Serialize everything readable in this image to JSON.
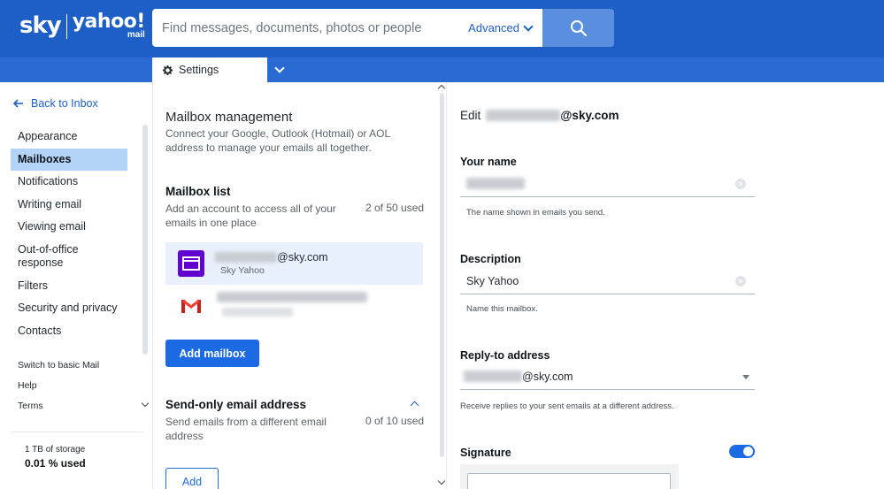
{
  "header": {
    "logo_sky": "sky",
    "logo_yahoo": "yahoo!",
    "logo_mail": "mail",
    "search_placeholder": "Find messages, documents, photos or people",
    "advanced_label": "Advanced",
    "settings_tab_label": "Settings"
  },
  "leftnav": {
    "back_label": "Back to Inbox",
    "items": [
      {
        "label": "Appearance",
        "active": false
      },
      {
        "label": "Mailboxes",
        "active": true
      },
      {
        "label": "Notifications",
        "active": false
      },
      {
        "label": "Writing email",
        "active": false
      },
      {
        "label": "Viewing email",
        "active": false
      },
      {
        "label": "Out-of-office response",
        "active": false
      },
      {
        "label": "Filters",
        "active": false
      },
      {
        "label": "Security and privacy",
        "active": false
      },
      {
        "label": "Contacts",
        "active": false
      }
    ],
    "switch_basic": "Switch to basic Mail",
    "help": "Help",
    "terms": "Terms",
    "storage_total": "1 TB of storage",
    "storage_used": "0.01 % used"
  },
  "middle": {
    "management_title": "Mailbox management",
    "management_desc": "Connect your Google, Outlook (Hotmail) or AOL address to manage your emails all together.",
    "list_title": "Mailbox list",
    "list_desc": "Add an account to access all of your emails in one place",
    "list_count": "2 of 50 used",
    "mailboxes": [
      {
        "address_suffix": "@sky.com",
        "name": "Sky Yahoo",
        "icon": "yahoo-mail-icon"
      },
      {
        "address_suffix": "",
        "name": "",
        "icon": "gmail-icon"
      }
    ],
    "add_mailbox_label": "Add mailbox",
    "sendonly_title": "Send-only email address",
    "sendonly_desc": "Send emails from a different email address",
    "sendonly_count": "0 of 10 used",
    "add_label": "Add"
  },
  "right": {
    "edit_prefix": "Edit",
    "edit_domain": "@sky.com",
    "your_name_label": "Your name",
    "your_name_value": "",
    "your_name_help": "The name shown in emails you send.",
    "description_label": "Description",
    "description_value": "Sky Yahoo",
    "description_help": "Name this mailbox.",
    "reply_label": "Reply-to address",
    "reply_value_suffix": "@sky.com",
    "reply_help": "Receive replies to your sent emails at a different address.",
    "signature_label": "Signature",
    "signature_enabled": true
  },
  "colors": {
    "header_blue": "#1d5fc6",
    "tabbar_blue": "#2b6ad3",
    "search_button": "#5a8fe0",
    "primary_button": "#1d6ae5",
    "active_nav": "#b3d3f7",
    "yahoo_purple": "#6001d2"
  }
}
